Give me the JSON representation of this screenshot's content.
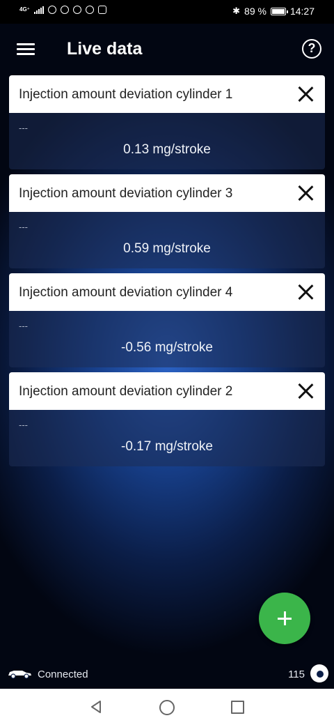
{
  "status_bar": {
    "network": "4G⁺",
    "battery": "89 %",
    "battery_level": 0.89,
    "time": "14:27"
  },
  "header": {
    "title": "Live data"
  },
  "cards": [
    {
      "title": "Injection amount deviation cylinder 1",
      "subtitle": "---",
      "value": "0.13 mg/stroke"
    },
    {
      "title": "Injection amount deviation cylinder 3",
      "subtitle": "---",
      "value": "0.59 mg/stroke"
    },
    {
      "title": "Injection amount deviation cylinder 4",
      "subtitle": "---",
      "value": "-0.56 mg/stroke"
    },
    {
      "title": "Injection amount deviation cylinder 2",
      "subtitle": "---",
      "value": "-0.17 mg/stroke"
    }
  ],
  "footer": {
    "connection_status": "Connected",
    "count": "115"
  },
  "colors": {
    "fab": "#3bb54a",
    "background": "#173f8a"
  }
}
